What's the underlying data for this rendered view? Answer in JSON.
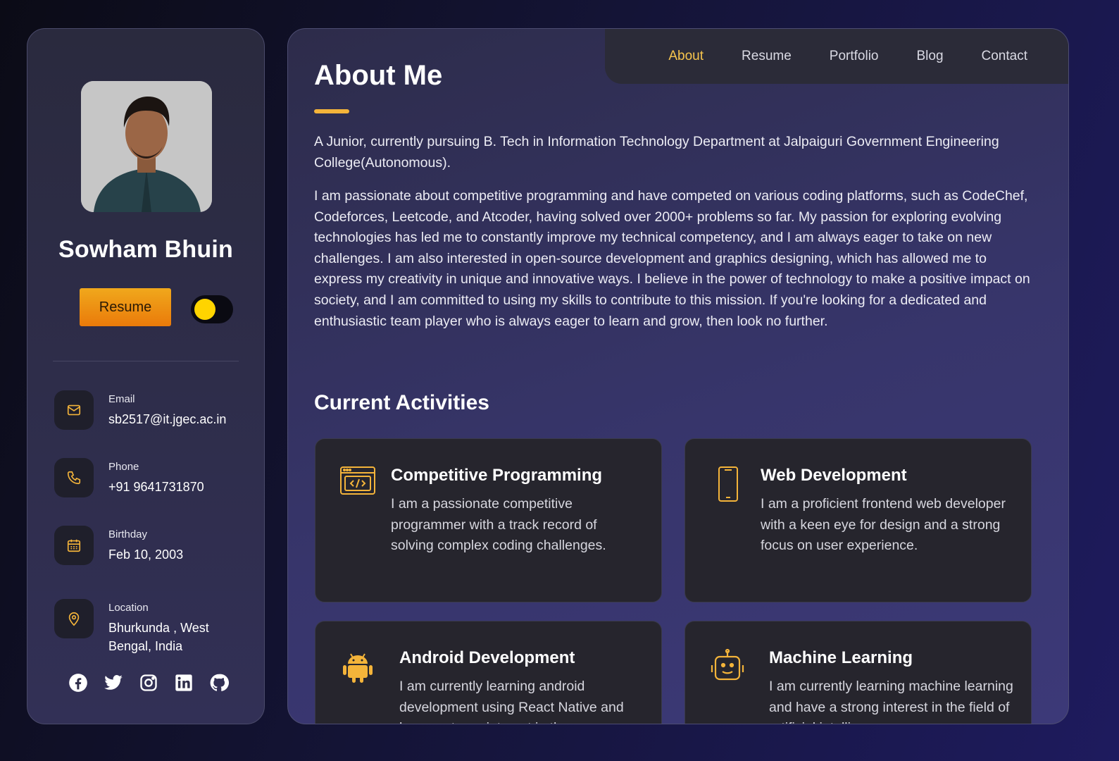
{
  "profile": {
    "name": "Sowham Bhuin",
    "resume_label": "Resume"
  },
  "contacts": [
    {
      "label": "Email",
      "value": "sb2517@it.jgec.ac.in",
      "icon": "mail-icon"
    },
    {
      "label": "Phone",
      "value": "+91 9641731870",
      "icon": "phone-icon"
    },
    {
      "label": "Birthday",
      "value": "Feb 10, 2003",
      "icon": "calendar-icon"
    },
    {
      "label": "Location",
      "value": "Bhurkunda , West Bengal, India",
      "icon": "location-pin-icon"
    }
  ],
  "socials": [
    "facebook-icon",
    "twitter-icon",
    "instagram-icon",
    "linkedin-icon",
    "github-icon"
  ],
  "nav": {
    "items": [
      "About",
      "Resume",
      "Portfolio",
      "Blog",
      "Contact"
    ],
    "active": "About"
  },
  "about": {
    "title": "About Me",
    "paragraph1": "A Junior, currently pursuing B. Tech in Information Technology Department at Jalpaiguri Government Engineering College(Autonomous).",
    "paragraph2": "I am passionate about competitive programming and have competed on various coding platforms, such as CodeChef, Codeforces, Leetcode, and Atcoder, having solved over 2000+ problems so far. My passion for exploring evolving technologies has led me to constantly improve my technical competency, and I am always eager to take on new challenges. I am also interested in open-source development and graphics designing, which has allowed me to express my creativity in unique and innovative ways. I believe in the power of technology to make a positive impact on society, and I am committed to using my skills to contribute to this mission. If you're looking for a dedicated and enthusiastic team player who is always eager to learn and grow, then look no further."
  },
  "activities": {
    "title": "Current Activities",
    "items": [
      {
        "title": "Competitive Programming",
        "text": "I am a passionate competitive programmer with a track record of solving complex coding challenges.",
        "icon": "code-window-icon"
      },
      {
        "title": "Web Development",
        "text": "I am a proficient frontend web developer with a keen eye for design and a strong focus on user experience.",
        "icon": "smartphone-icon"
      },
      {
        "title": "Android Development",
        "text": "I am currently learning android development using React Native and have a strong interest in the",
        "icon": "android-icon"
      },
      {
        "title": "Machine Learning",
        "text": "I am currently learning machine learning and have a strong interest in the field of artificial intelligence",
        "icon": "robot-icon"
      }
    ]
  },
  "colors": {
    "accent": "#f4b43a",
    "active_nav": "#f7c54d",
    "toggle_knob": "#ffd400",
    "card_bg": "#26252d"
  }
}
